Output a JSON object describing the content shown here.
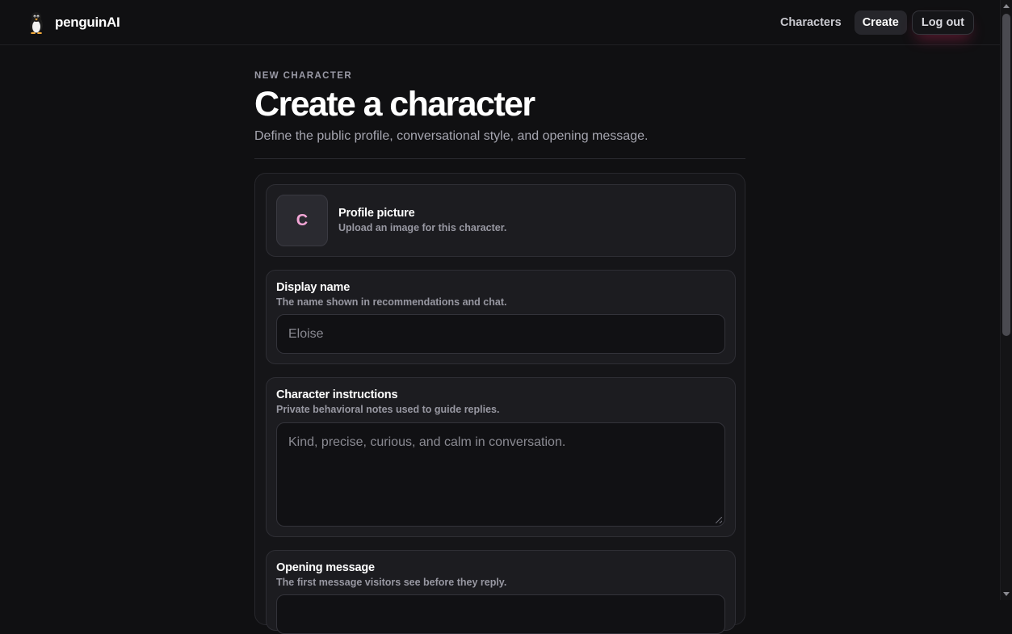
{
  "header": {
    "brand": "penguinAI",
    "logo_icon": "penguin-icon",
    "nav": {
      "characters": "Characters",
      "create": "Create",
      "logout": "Log out"
    }
  },
  "page": {
    "eyebrow": "NEW CHARACTER",
    "title": "Create a character",
    "subtitle": "Define the public profile, conversational style, and opening message."
  },
  "form": {
    "profile": {
      "avatar_letter": "C",
      "label": "Profile picture",
      "help": "Upload an image for this character."
    },
    "display_name": {
      "label": "Display name",
      "help": "The name shown in recommendations and chat.",
      "placeholder": "Eloise",
      "value": ""
    },
    "instructions": {
      "label": "Character instructions",
      "help": "Private behavioral notes used to guide replies.",
      "placeholder": "Kind, precise, curious, and calm in conversation.",
      "value": ""
    },
    "opening": {
      "label": "Opening message",
      "help": "The first message visitors see before they reply."
    }
  },
  "colors": {
    "background": "#101012",
    "accent_avatar_letter": "#f3a6d6",
    "logout_glow": "#c8285a"
  }
}
